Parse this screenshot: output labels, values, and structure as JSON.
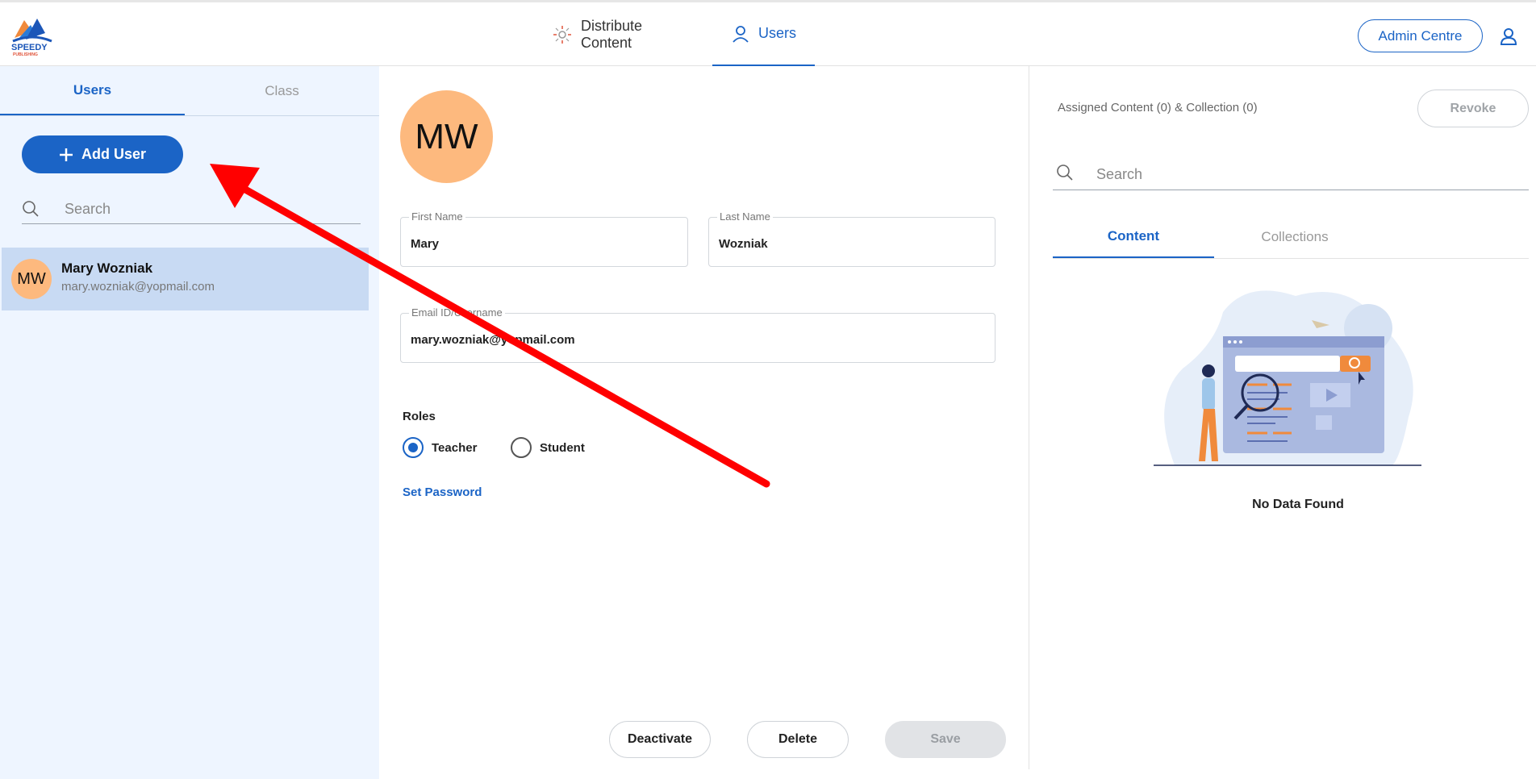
{
  "brand": {
    "logo_text": "SPEEDY",
    "logo_subtext": "PUBLISHING"
  },
  "nav": {
    "distribute": "Distribute Content",
    "users": "Users",
    "admin_centre": "Admin Centre"
  },
  "left_panel": {
    "tabs": [
      {
        "label": "Users"
      },
      {
        "label": "Class"
      }
    ],
    "add_user": "Add User",
    "search_placeholder": "Search",
    "users": [
      {
        "initials": "MW",
        "name": "Mary Wozniak",
        "email": "mary.wozniak@yopmail.com"
      }
    ]
  },
  "detail": {
    "initials": "MW",
    "first_name_label": "First Name",
    "first_name": "Mary",
    "last_name_label": "Last Name",
    "last_name": "Wozniak",
    "email_label": "Email ID/Username",
    "email": "mary.wozniak@yopmail.com",
    "roles_label": "Roles",
    "roles": [
      {
        "label": "Teacher",
        "selected": true
      },
      {
        "label": "Student",
        "selected": false
      }
    ],
    "set_password": "Set Password",
    "buttons": {
      "deactivate": "Deactivate",
      "delete": "Delete",
      "save": "Save"
    }
  },
  "assigned": {
    "title": "Assigned Content (0) & Collection (0)",
    "revoke": "Revoke",
    "search_placeholder": "Search",
    "tabs": [
      {
        "label": "Content"
      },
      {
        "label": "Collections"
      }
    ],
    "empty_text": "No Data Found"
  },
  "colors": {
    "accent": "#1b64c6",
    "avatar": "#fdb97e",
    "sidebar_bg": "#eef5ff",
    "selected_row": "#c8daf3",
    "annotation_arrow": "#ff0000"
  }
}
